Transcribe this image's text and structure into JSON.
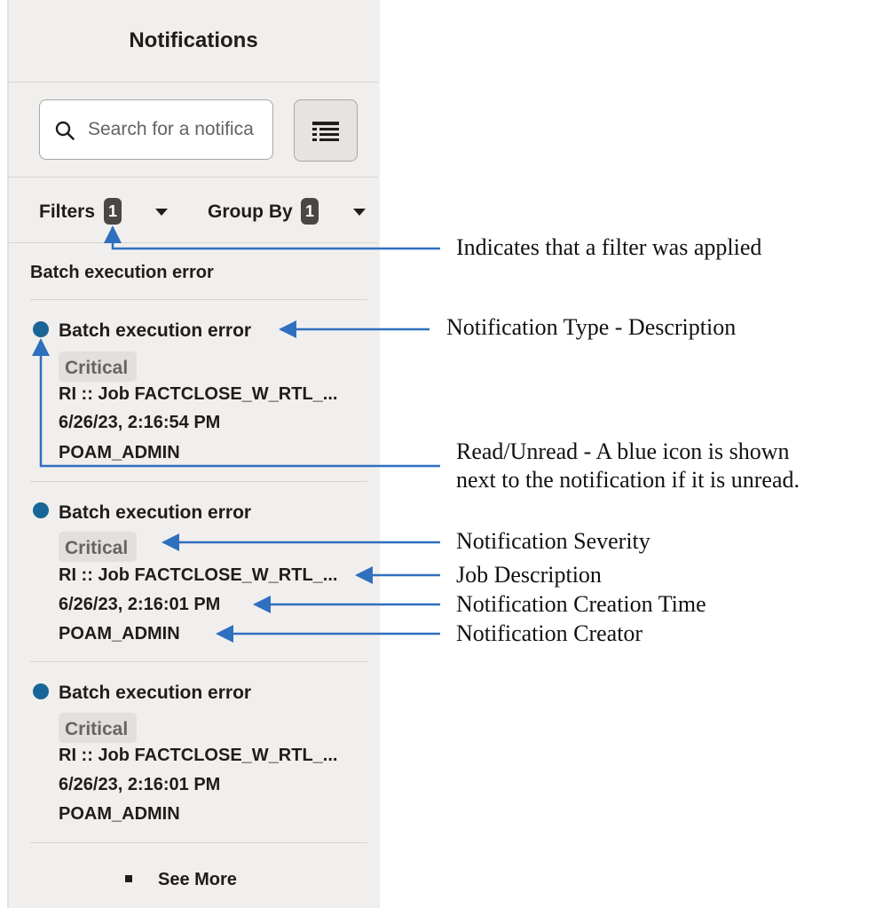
{
  "panel": {
    "title": "Notifications",
    "search": {
      "placeholder": "Search for a notifica"
    },
    "filters": {
      "label": "Filters",
      "count": "1"
    },
    "group_by": {
      "label": "Group By",
      "count": "1"
    },
    "section_label": "Batch execution error",
    "notifications": [
      {
        "title": "Batch execution error",
        "severity": "Critical",
        "description": "RI :: Job FACTCLOSE_W_RTL_...",
        "time": "6/26/23, 2:16:54 PM",
        "creator": "POAM_ADMIN",
        "unread": true
      },
      {
        "title": "Batch execution error",
        "severity": "Critical",
        "description": "RI :: Job FACTCLOSE_W_RTL_...",
        "time": "6/26/23, 2:16:01 PM",
        "creator": "POAM_ADMIN",
        "unread": true
      },
      {
        "title": "Batch execution error",
        "severity": "Critical",
        "description": "RI :: Job FACTCLOSE_W_RTL_...",
        "time": "6/26/23, 2:16:01 PM",
        "creator": "POAM_ADMIN",
        "unread": true
      }
    ],
    "see_more": "See More"
  },
  "annotations": {
    "filter_applied": "Indicates that a filter was applied",
    "type_description": "Notification Type - Description",
    "read_unread_line1": "Read/Unread - A blue icon is shown",
    "read_unread_line2": "next to the notification if it is unread.",
    "severity": "Notification Severity",
    "job_description": "Job Description",
    "creation_time": "Notification Creation Time",
    "creator": "Notification Creator"
  },
  "colors": {
    "unread_dot": "#1a6597",
    "arrow": "#2f6fc0",
    "panel_bg": "#f1efed"
  },
  "icons": {
    "search": "search-icon",
    "view": "list-view-icon",
    "dropdown": "caret-down-icon"
  }
}
